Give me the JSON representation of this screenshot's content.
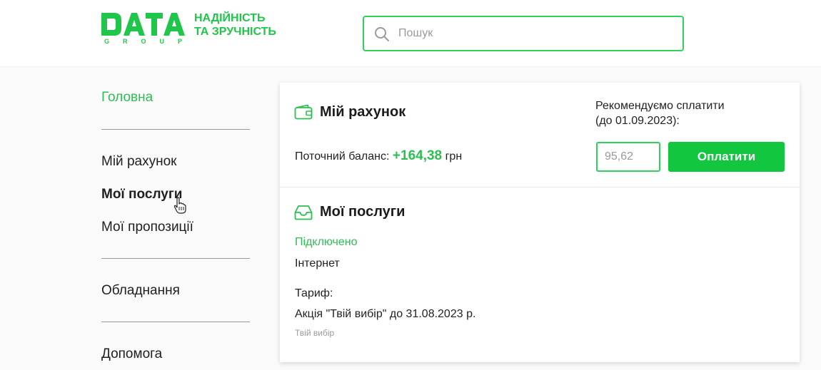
{
  "header": {
    "logo_text": "DATA",
    "logo_subtext": "GROUP",
    "slogan_line1": "НАДІЙНІСТЬ",
    "slogan_line2": "ТА ЗРУЧНІСТЬ",
    "search_placeholder": "Пошук"
  },
  "sidebar": {
    "items": [
      {
        "label": "Головна"
      },
      {
        "label": "Мій рахунок"
      },
      {
        "label": "Мої послуги"
      },
      {
        "label": "Мої пропозиції"
      },
      {
        "label": "Обладнання"
      },
      {
        "label": "Допомога"
      }
    ]
  },
  "account": {
    "title": "Мій рахунок",
    "balance_label": "Поточний баланс:",
    "balance_amount": "+164,38",
    "currency": "грн",
    "recommend_line1": "Рекомендуємо сплатити",
    "recommend_line2": "(до 01.09.2023):",
    "pay_amount": "95,62",
    "pay_button": "Оплатити"
  },
  "services": {
    "title": "Мої послуги",
    "status": "Підключено",
    "service_name": "Інтернет",
    "tariff_label": "Тариф:",
    "tariff_value": "Акція \"Твій вибір\" до 31.08.2023 р.",
    "tariff_note": "Твій вибір"
  },
  "colors": {
    "brand_green": "#1fc64a",
    "button_green": "#13c63f",
    "accent_text": "#2cbf52"
  }
}
